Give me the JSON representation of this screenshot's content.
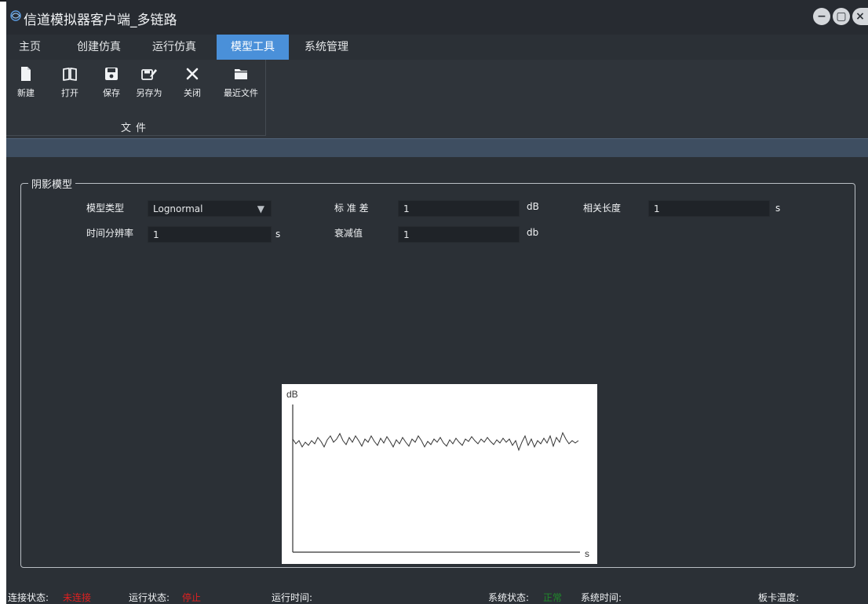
{
  "window": {
    "title": "信道模拟器客户端_多链路",
    "controls": [
      "minimize-icon",
      "maximize-icon",
      "close-icon"
    ]
  },
  "menu": {
    "tabs": [
      "主页",
      "创建仿真",
      "运行仿真",
      "模型工具",
      "系统管理"
    ],
    "active": "模型工具"
  },
  "ribbon": {
    "group_label": "文件",
    "buttons": [
      {
        "label": "新建",
        "icon": "new-file-icon"
      },
      {
        "label": "打开",
        "icon": "open-book-icon"
      },
      {
        "label": "保存",
        "icon": "save-disk-icon"
      },
      {
        "label": "另存为",
        "icon": "save-as-icon"
      },
      {
        "label": "关闭",
        "icon": "close-x-icon"
      },
      {
        "label": "最近文件",
        "icon": "folder-icon"
      }
    ]
  },
  "shadow_model": {
    "title": "阴影模型",
    "model_type": {
      "label": "模型类型",
      "value": "Lognormal"
    },
    "std_dev": {
      "label": "标 准 差",
      "value": "1",
      "unit": "dB"
    },
    "corr_length": {
      "label": "相关长度",
      "value": "1",
      "unit": "s"
    },
    "time_res": {
      "label": "时间分辨率",
      "value": "1",
      "unit": "s"
    },
    "attenuation": {
      "label": "衰减值",
      "value": "1",
      "unit": "db"
    }
  },
  "preview": {
    "y_label": "dB",
    "x_label": "s"
  },
  "status": {
    "conn_label": "连接状态:",
    "conn_value": "未连接",
    "run_label": "运行状态:",
    "run_value": "停止",
    "run_time_label": "运行时间:",
    "sys_label": "系统状态:",
    "sys_value": "正常",
    "sys_time_label": "系统时间:",
    "board_temp_label": "板卡温度:"
  },
  "colors": {
    "accent": "#4a90d9",
    "error": "#e02020",
    "ok": "#1f8a2a",
    "panel": "#2b3036"
  }
}
